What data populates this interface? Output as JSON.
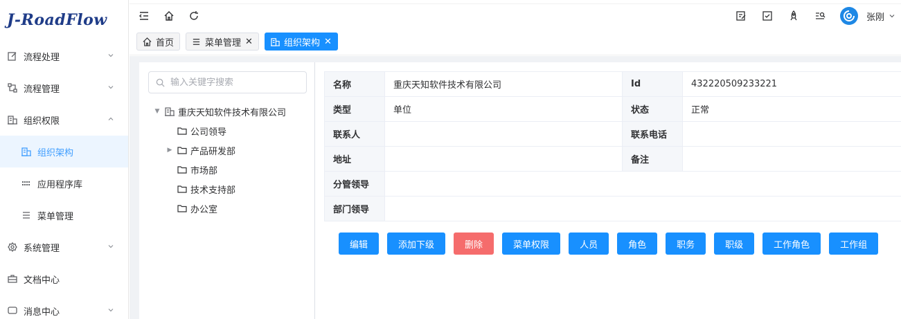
{
  "app": {
    "logo": "J-RoadFlow"
  },
  "sidebar": {
    "items": [
      {
        "label": "流程处理",
        "icon": "edit-icon",
        "expandable": true
      },
      {
        "label": "流程管理",
        "icon": "flow-icon",
        "expandable": true
      },
      {
        "label": "组织权限",
        "icon": "building-icon",
        "expandable": true,
        "expanded": true
      },
      {
        "label": "组织架构",
        "icon": "building-icon",
        "active": true,
        "sub": true
      },
      {
        "label": "应用程序库",
        "icon": "grid-icon",
        "sub": true
      },
      {
        "label": "菜单管理",
        "icon": "menu-icon",
        "sub": true
      },
      {
        "label": "系统管理",
        "icon": "gear-icon",
        "expandable": true
      },
      {
        "label": "文档中心",
        "icon": "briefcase-icon"
      },
      {
        "label": "消息中心",
        "icon": "chat-icon",
        "expandable": true
      }
    ]
  },
  "header": {
    "toolbar_left": [
      "collapse-menu-icon",
      "home-icon",
      "refresh-icon"
    ],
    "toolbar_right": [
      "edit-task-icon",
      "check-task-icon",
      "rocket-icon",
      "search-list-icon"
    ],
    "username": "张刚"
  },
  "tabs": [
    {
      "label": "首页",
      "icon": "home-icon",
      "closable": false,
      "active": false
    },
    {
      "label": "菜单管理",
      "icon": "menu-icon",
      "closable": true,
      "active": false
    },
    {
      "label": "组织架构",
      "icon": "building-icon",
      "closable": true,
      "active": true
    }
  ],
  "tree": {
    "search_placeholder": "输入关键字搜索",
    "root": {
      "label": "重庆天知软件技术有限公司",
      "expanded": true
    },
    "children": [
      {
        "label": "公司领导",
        "has_children": false
      },
      {
        "label": "产品研发部",
        "has_children": true
      },
      {
        "label": "市场部",
        "has_children": false
      },
      {
        "label": "技术支持部",
        "has_children": false
      },
      {
        "label": "办公室",
        "has_children": false
      }
    ]
  },
  "detail": {
    "rows": [
      {
        "l1": "名称",
        "v1": "重庆天知软件技术有限公司",
        "l2": "Id",
        "v2": "432220509233221"
      },
      {
        "l1": "类型",
        "v1": "单位",
        "l2": "状态",
        "v2": "正常"
      },
      {
        "l1": "联系人",
        "v1": "",
        "l2": "联系电话",
        "v2": ""
      },
      {
        "l1": "地址",
        "v1": "",
        "l2": "备注",
        "v2": ""
      },
      {
        "l1": "分管领导",
        "v1": ""
      },
      {
        "l1": "部门领导",
        "v1": ""
      }
    ],
    "buttons": {
      "edit": "编辑",
      "add_child": "添加下级",
      "delete": "删除",
      "menu_permission": "菜单权限",
      "staff": "人员",
      "role": "角色",
      "duty": "职务",
      "rank": "职级",
      "work_role": "工作角色",
      "work_group": "工作组"
    },
    "colors": {
      "primary": "#1890ff",
      "danger": "#f56c6c"
    }
  }
}
